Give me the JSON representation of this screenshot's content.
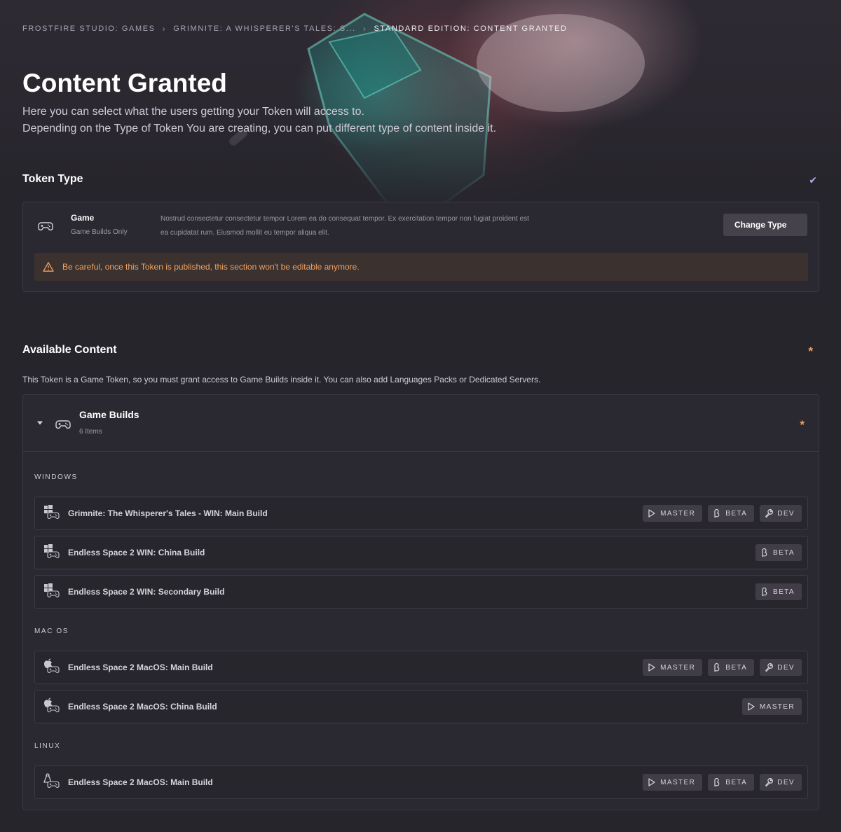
{
  "breadcrumb": {
    "items": [
      "FROSTFIRE STUDIO: GAMES",
      "GRIMNITE: A WHISPERER'S TALES: S...",
      "STANDARD EDITION: CONTENT GRANTED"
    ]
  },
  "page": {
    "title": "Content Granted",
    "description_line1": "Here you can select what the users getting your Token will access to.",
    "description_line2": "Depending on the Type of Token You are creating, you can put different type of content inside it."
  },
  "token_type": {
    "section_title": "Token Type",
    "name": "Game",
    "subtitle": "Game Builds Only",
    "description": "Nostrud consectetur consectetur tempor Lorem ea do consequat tempor. Ex exercitation tempor non fugiat proident est ea cupidatat rum. Eiusmod mollit eu tempor aliqua elit.",
    "change_button": "Change Type",
    "warning": "Be careful, once this Token is published, this section won't be editable anymore."
  },
  "available_content": {
    "section_title": "Available Content",
    "required_mark": "*",
    "description": "This Token is a Game Token, so you must grant access to Game Builds inside it. You can also add Languages Packs or Dedicated Servers.",
    "game_builds": {
      "title": "Game Builds",
      "count": "6 Items",
      "required_mark": "*",
      "groups": [
        {
          "os": "WINDOWS",
          "builds": [
            {
              "name": "Grimnite: The Whisperer's Tales -  WIN: Main Build",
              "tags": [
                "MASTER",
                "BETA",
                "DEV"
              ]
            },
            {
              "name": "Endless Space 2 WIN: China Build",
              "tags": [
                "BETA"
              ]
            },
            {
              "name": "Endless Space 2 WIN: Secondary Build",
              "tags": [
                "BETA"
              ]
            }
          ]
        },
        {
          "os": "MAC OS",
          "builds": [
            {
              "name": "Endless Space 2 MacOS: Main Build",
              "tags": [
                "MASTER",
                "BETA",
                "DEV"
              ]
            },
            {
              "name": "Endless Space 2 MacOS: China Build",
              "tags": [
                "MASTER"
              ]
            }
          ]
        },
        {
          "os": "LINUX",
          "builds": [
            {
              "name": "Endless Space 2 MacOS: Main Build",
              "tags": [
                "MASTER",
                "BETA",
                "DEV"
              ]
            }
          ]
        }
      ]
    }
  },
  "icons": {
    "breadcrumb_separator": "chevron-right-icon",
    "token_type_check": "check-icon",
    "token_type": "gamepad-icon",
    "warning": "warning-triangle-icon",
    "collapse": "caret-down-icon",
    "tag_master": "play-icon",
    "tag_beta": "beta-icon",
    "tag_dev": "wrench-icon"
  },
  "colors": {
    "background": "#27252c",
    "card": "#2a2830",
    "warning_text": "#f0a062",
    "warning_bg": "#3b322f",
    "check": "#b4a7ea",
    "tag_bg": "#403d46"
  }
}
